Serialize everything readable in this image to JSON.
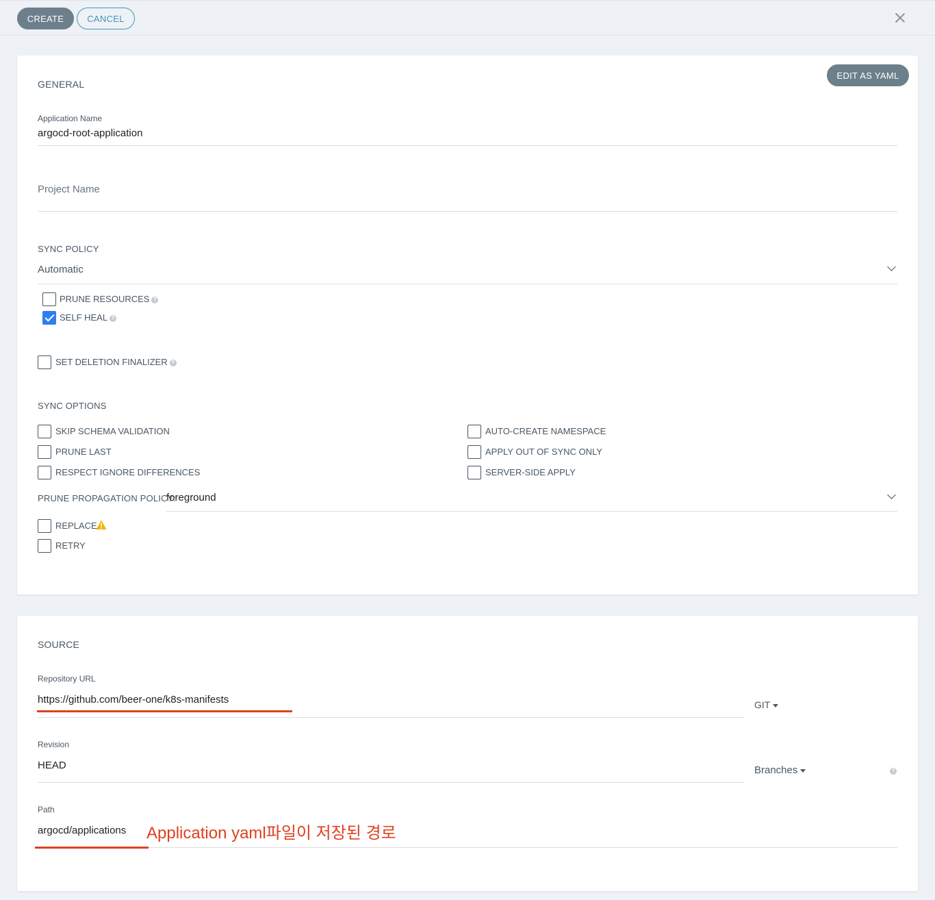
{
  "toolbar": {
    "create_label": "CREATE",
    "cancel_label": "CANCEL"
  },
  "general": {
    "title": "GENERAL",
    "edit_yaml_label": "EDIT AS YAML",
    "application_name_label": "Application Name",
    "application_name_value": "argocd-root-application",
    "project_name_placeholder": "Project Name",
    "sync_policy_label": "SYNC POLICY",
    "sync_policy_value": "Automatic",
    "prune_resources_label": "PRUNE RESOURCES",
    "prune_resources_checked": false,
    "self_heal_label": "SELF HEAL",
    "self_heal_checked": true,
    "set_deletion_finalizer_label": "SET DELETION FINALIZER",
    "sync_options_label": "SYNC OPTIONS",
    "sync_options": {
      "skip_schema_validation": "SKIP SCHEMA VALIDATION",
      "prune_last": "PRUNE LAST",
      "respect_ignore_differences": "RESPECT IGNORE DIFFERENCES",
      "auto_create_namespace": "AUTO-CREATE NAMESPACE",
      "apply_out_of_sync_only": "APPLY OUT OF SYNC ONLY",
      "server_side_apply": "SERVER-SIDE APPLY"
    },
    "prune_propagation_label": "PRUNE PROPAGATION POLICY:",
    "prune_propagation_value": "foreground",
    "replace_label": "REPLACE",
    "retry_label": "RETRY"
  },
  "source": {
    "title": "SOURCE",
    "repository_url_label": "Repository URL",
    "repository_url_value": "https://github.com/beer-one/k8s-manifests",
    "repo_type": "GIT",
    "revision_label": "Revision",
    "revision_value": "HEAD",
    "revision_type": "Branches",
    "path_label": "Path",
    "path_value": "argocd/applications",
    "path_annotation": "Application yaml파일이 저장된 경로"
  },
  "colors": {
    "accent": "#2f7ef0",
    "annotation_red": "#e0401f",
    "button_dark": "#6d7f8b",
    "button_outline": "#3c99b8"
  }
}
